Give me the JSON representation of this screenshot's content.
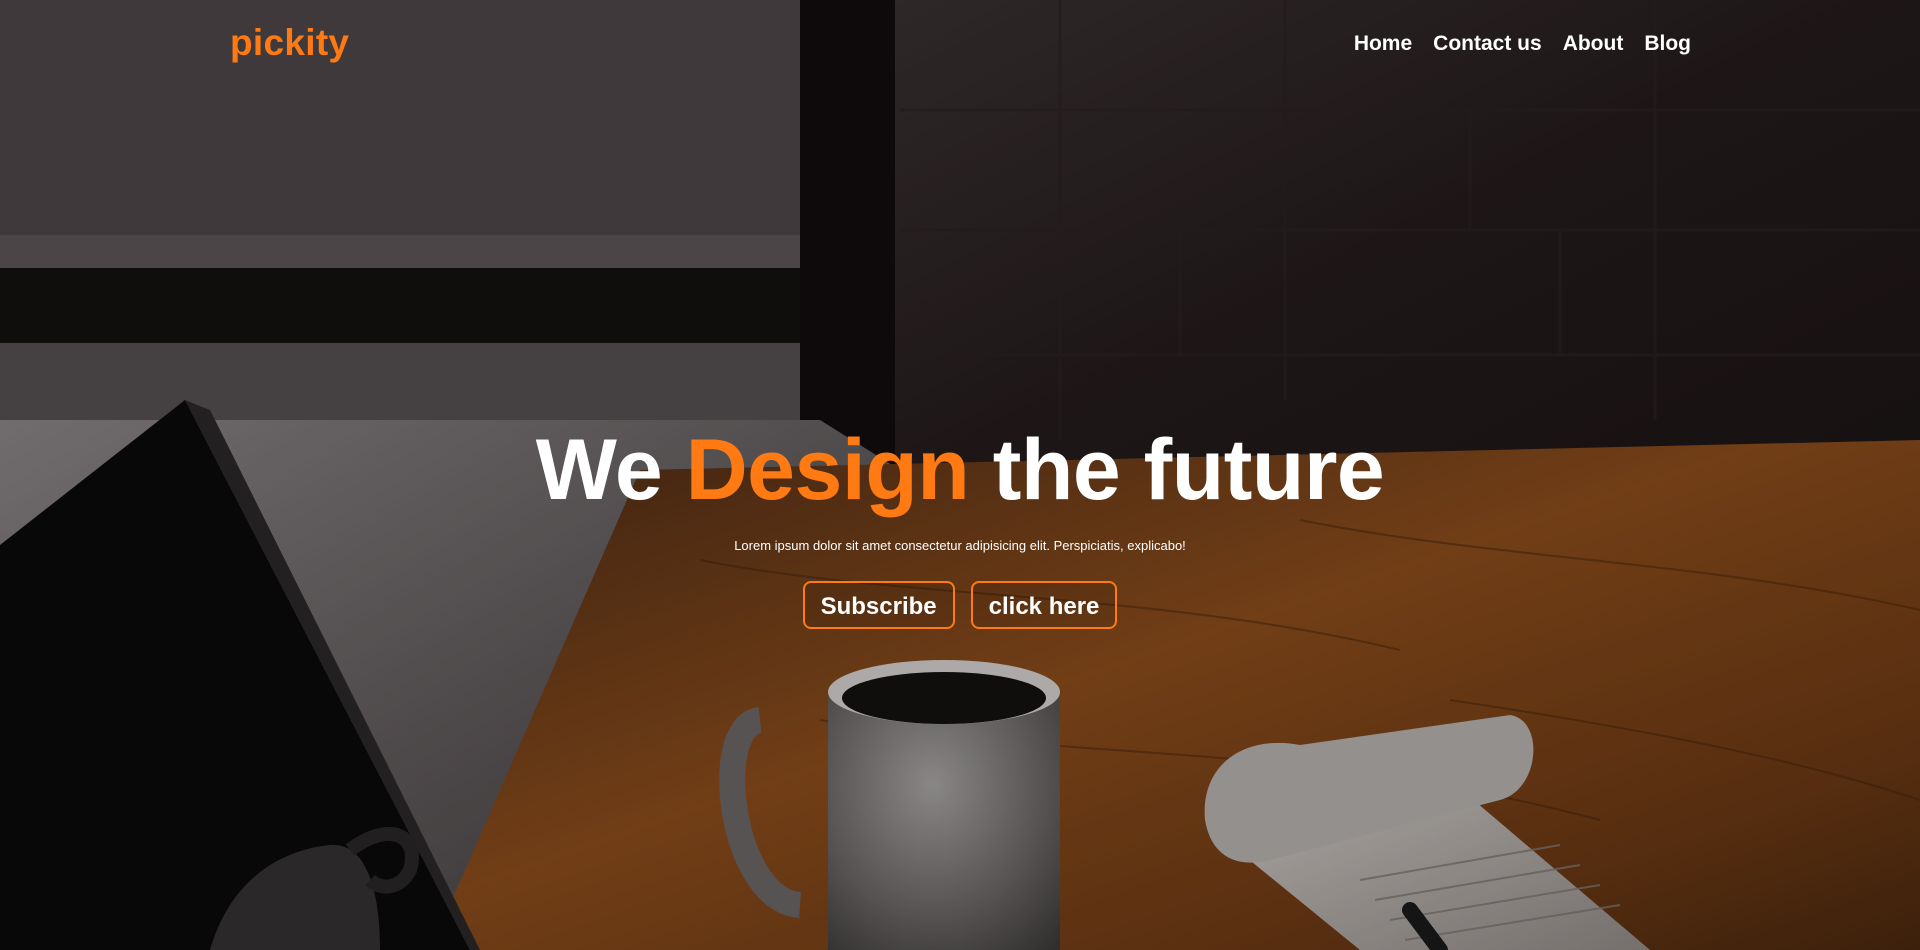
{
  "brand": {
    "logo_text": "pickity",
    "accent_color": "#ff7a12"
  },
  "nav": {
    "items": [
      {
        "label": "Home"
      },
      {
        "label": "Contact us"
      },
      {
        "label": "About"
      },
      {
        "label": "Blog"
      }
    ]
  },
  "hero": {
    "headline_start": "We",
    "headline_accent": "Design",
    "headline_end": "the future",
    "subtitle": "Lorem ipsum dolor sit amet consectetur adipisicing elit. Perspiciatis, explicabo!",
    "buttons": [
      {
        "label": "Subscribe"
      },
      {
        "label": "click here"
      }
    ],
    "background_description_icon": "desk-workspace-photo"
  }
}
